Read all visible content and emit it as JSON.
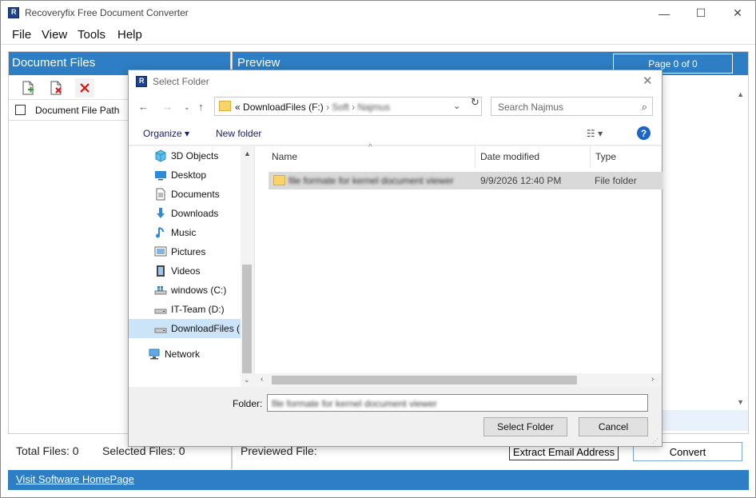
{
  "app": {
    "title": "Recoveryfix Free Document Converter",
    "controls": {
      "minimize": "—",
      "maximize": "☐",
      "close": "✕"
    }
  },
  "menu": {
    "items": [
      "File",
      "View",
      "Tools",
      "Help"
    ]
  },
  "left_panel": {
    "title": "Document Files",
    "toolbar": {
      "add_icon": "add-file-icon",
      "remove_icon": "remove-file-icon",
      "close_icon": "close-icon"
    },
    "column_header": "Document File Path"
  },
  "preview": {
    "title": "Preview",
    "page_indicator": "Page 0 of 0"
  },
  "status": {
    "total_files": "Total Files: 0",
    "selected_files": "Selected Files: 0",
    "previewed_file": "Previewed File:",
    "extract_button": "Extract Email Address",
    "convert_button": "Convert"
  },
  "footer": {
    "link": "Visit Software HomePage"
  },
  "dialog": {
    "title": "Select Folder",
    "close": "✕",
    "address": {
      "prefix": "«",
      "path_visible": "DownloadFiles (F:)",
      "sep": "›",
      "blurred_1": "Soft",
      "blurred_2": "Najmus"
    },
    "search_placeholder": "Search Najmus",
    "commands": {
      "organize": "Organize ▾",
      "new_folder": "New folder"
    },
    "nav_items": [
      {
        "label": "3D Objects",
        "icon": "3d-objects-icon"
      },
      {
        "label": "Desktop",
        "icon": "desktop-icon"
      },
      {
        "label": "Documents",
        "icon": "documents-icon"
      },
      {
        "label": "Downloads",
        "icon": "downloads-icon"
      },
      {
        "label": "Music",
        "icon": "music-icon"
      },
      {
        "label": "Pictures",
        "icon": "pictures-icon"
      },
      {
        "label": "Videos",
        "icon": "videos-icon"
      },
      {
        "label": "windows (C:)",
        "icon": "drive-icon"
      },
      {
        "label": "IT-Team (D:)",
        "icon": "drive-icon"
      },
      {
        "label": "DownloadFiles (I",
        "icon": "drive-icon",
        "selected": true
      },
      {
        "label": "Network",
        "icon": "network-icon"
      }
    ],
    "columns": [
      "Name",
      "Date modified",
      "Type"
    ],
    "files": [
      {
        "name": "file formate for kernel document viewer",
        "date": "9/9/2026 12:40 PM",
        "type": "File folder"
      }
    ],
    "folder_label": "Folder:",
    "folder_value": "file formate for kernel document viewer",
    "select_button": "Select Folder",
    "cancel_button": "Cancel"
  },
  "colors": {
    "accent_blue": "#2d7ec4",
    "selection": "#cce4f7"
  }
}
